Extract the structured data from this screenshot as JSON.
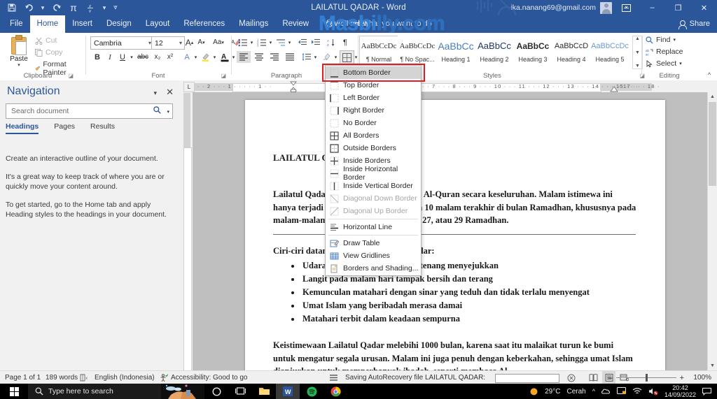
{
  "titlebar": {
    "document_title": "LAILATUL QADAR  -  Word",
    "account_email": "ika.nanang69@gmail.com",
    "qat": [
      "save-icon",
      "undo-icon",
      "redo-icon",
      "pi-icon",
      "fraction-icon",
      "customize-qat-icon"
    ],
    "ribbon_display_options": "ribbon-display-icon",
    "minimize": "–",
    "restore": "❐",
    "close": "✕"
  },
  "watermark": {
    "part1": "Masbi",
    "part2": "lly.com"
  },
  "tabs": [
    {
      "label": "File",
      "active": false
    },
    {
      "label": "Home",
      "active": true
    },
    {
      "label": "Insert",
      "active": false
    },
    {
      "label": "Design",
      "active": false
    },
    {
      "label": "Layout",
      "active": false
    },
    {
      "label": "References",
      "active": false
    },
    {
      "label": "Mailings",
      "active": false
    },
    {
      "label": "Review",
      "active": false
    },
    {
      "label": "View",
      "active": false
    },
    {
      "label": "Help",
      "active": false
    }
  ],
  "tellme": "Tell me what you want to do",
  "share": "Share",
  "ribbon": {
    "clipboard": {
      "group_label": "Clipboard",
      "paste": "Paste",
      "cut": "Cut",
      "copy": "Copy",
      "format_painter": "Format Painter"
    },
    "font": {
      "group_label": "Font",
      "font_name": "Cambria",
      "font_size": "12",
      "grow_font": "A",
      "shrink_font": "A",
      "change_case": "Aa",
      "clear_formatting": "clear-formatting-icon",
      "bold": "B",
      "italic": "I",
      "underline": "U",
      "strikethrough": "abc",
      "subscript": "x₂",
      "superscript": "x²",
      "text_effects": "A",
      "highlight": "highlight-icon",
      "font_color": "A"
    },
    "paragraph": {
      "group_label": "Paragraph",
      "bullets": "bullets-icon",
      "numbering": "numbering-icon",
      "multilevel": "multilevel-list-icon",
      "decrease_indent": "decrease-indent-icon",
      "increase_indent": "increase-indent-icon",
      "sort": "sort-icon",
      "show_marks": "¶",
      "align_left": "align-left-icon",
      "align_center": "align-center-icon",
      "align_right": "align-right-icon",
      "justify": "justify-icon",
      "line_spacing": "line-spacing-icon",
      "shading": "shading-icon",
      "borders": "borders-icon"
    },
    "styles": {
      "group_label": "Styles",
      "items": [
        {
          "preview": "AaBbCcDc",
          "name": "¶ Normal"
        },
        {
          "preview": "AaBbCcDc",
          "name": "¶ No Spac..."
        },
        {
          "preview": "AaBbCc",
          "name": "Heading 1"
        },
        {
          "preview": "AaBbCc",
          "name": "Heading 2"
        },
        {
          "preview": "AaBbCc",
          "name": "Heading 3"
        },
        {
          "preview": "AaBbCcD",
          "name": "Heading 4"
        },
        {
          "preview": "AaBbCcDc",
          "name": "Heading 5"
        }
      ]
    },
    "editing": {
      "group_label": "Editing",
      "find": "Find",
      "replace": "Replace",
      "select": "Select"
    },
    "collapse_ribbon": "^"
  },
  "borders_menu": {
    "items": [
      {
        "label": "Bottom Border",
        "mnemonic": "B",
        "state": "highlighted"
      },
      {
        "label": "Top Border",
        "mnemonic": "T",
        "state": "normal"
      },
      {
        "label": "Left Border",
        "mnemonic": "L",
        "state": "normal"
      },
      {
        "label": "Right Border",
        "mnemonic": "R",
        "state": "normal"
      },
      {
        "label": "No Border",
        "mnemonic": "N",
        "state": "normal"
      },
      {
        "label": "All Borders",
        "mnemonic": "A",
        "state": "normal"
      },
      {
        "label": "Outside Borders",
        "mnemonic": "s",
        "state": "normal"
      },
      {
        "label": "Inside Borders",
        "mnemonic": "I",
        "state": "normal"
      },
      {
        "label": "Inside Horizontal Border",
        "mnemonic": "H",
        "state": "normal"
      },
      {
        "label": "Inside Vertical Border",
        "mnemonic": "V",
        "state": "normal"
      },
      {
        "label": "Diagonal Down Border",
        "mnemonic": "w",
        "state": "disabled"
      },
      {
        "label": "Diagonal Up Border",
        "mnemonic": "U",
        "state": "disabled"
      },
      {
        "label": "Horizontal Line",
        "mnemonic": "z",
        "state": "normal"
      },
      {
        "label": "Draw Table",
        "mnemonic": "D",
        "state": "normal"
      },
      {
        "label": "View Gridlines",
        "mnemonic": "G",
        "state": "normal"
      },
      {
        "label": "Borders and Shading...",
        "mnemonic": "o",
        "state": "normal"
      }
    ],
    "highlight_color": "#e11b22"
  },
  "navigation": {
    "title": "Navigation",
    "search_placeholder": "Search document",
    "search_value": "",
    "tabs": [
      {
        "label": "Headings",
        "active": true
      },
      {
        "label": "Pages",
        "active": false
      },
      {
        "label": "Results",
        "active": false
      }
    ],
    "body": [
      "Create an interactive outline of your document.",
      "It's a great way to keep track of where you are or quickly move your content around.",
      "To get started, go to the Home tab and apply Heading styles to the headings in your document."
    ]
  },
  "ruler": {
    "horizontal_ticks": "·  ·  2  ·  ·  ·  1  ·  ·  ·      ·  ·  1  ·  ·",
    "horizontal_ticks_right": "·  ·  7  ·  ·  ·  8  ·  ·  ·  9  ·  ·  ·  10  ·  ·  ·  11  ·  ·  ·  12  ·  ·  ·  13  ·  ·  ·  14  ·  ·  ·  15  ·  ·  ·",
    "horizontal_ticks_far": "·  ·  17  ·  ·  ·  18  ·",
    "tab_selector": "L"
  },
  "document": {
    "heading": "LAILATUL QADAR",
    "paragraph1": "Lailatul Qadar adalah malam turunnya Al-Quran secara keseluruhan. Malam istimewa ini hanya terjadi setahun sekali, yaitu pada 10 malam terakhir di bulan Ramadhan, khususnya pada malam-malam ganjil, seperti 21, 23, 25, 27, atau 29 Ramadhan.",
    "section2_heading": "Ciri-ciri datangnya malam Lailatul Qadar:",
    "bullets": [
      "Udara dan suasana pagi terasa tenang menyejukkan",
      "Langit pada malam hari tampak bersih dan terang",
      "Kemunculan matahari dengan sinar yang teduh dan tidak terlalu menyengat",
      "Umat Islam yang beribadah merasa damai",
      "Matahari terbit dalam keadaan sempurna"
    ],
    "paragraph3": "Keistimewaan Lailatul Qadar melebihi 1000 bulan, karena saat itu malaikat turun ke bumi untuk mengatur segala urusan. Malam ini juga penuh dengan keberkahan, sehingga umat Islam dianjurkan untuk memperbanyak ibadah, seperti membaca Al-"
  },
  "status_bar": {
    "page": "Page 1 of 1",
    "words": "189 words",
    "proofing_icon": "spelling-check-icon",
    "language": "English (Indonesia)",
    "accessibility": "Accessibility: Good to go",
    "autorecovery": "Saving AutoRecovery file LAILATUL QADAR:",
    "progress_value": 0,
    "cancel_icon": "cancel-icon",
    "views": [
      "read-mode-icon",
      "print-layout-icon",
      "web-layout-icon"
    ],
    "active_view": "print-layout-icon",
    "zoom_out": "–",
    "zoom_in": "+",
    "zoom_level": "100%"
  },
  "taskbar": {
    "start": "windows-start-icon",
    "search_placeholder": "Type here to search",
    "items": [
      {
        "name": "weather-widget",
        "label": ""
      },
      {
        "name": "cortana-icon",
        "label": ""
      },
      {
        "name": "task-view-icon",
        "label": ""
      },
      {
        "name": "file-explorer-icon",
        "label": ""
      },
      {
        "name": "word-icon",
        "label": "W"
      },
      {
        "name": "spotify-icon",
        "label": ""
      },
      {
        "name": "chrome-icon",
        "label": ""
      }
    ],
    "tray": {
      "weather_temp": "29°C",
      "weather_desc": "Cerah",
      "chevron": "^",
      "icons": [
        "onedrive-icon",
        "screen-icon",
        "wifi-icon",
        "volume-icon"
      ],
      "time": "20:42",
      "date": "14/09/2022",
      "notifications": "notification-icon"
    }
  },
  "colors": {
    "word_blue": "#2b579a",
    "accent_red": "#e11b22",
    "watermark_blue": "#2f7fd6"
  }
}
